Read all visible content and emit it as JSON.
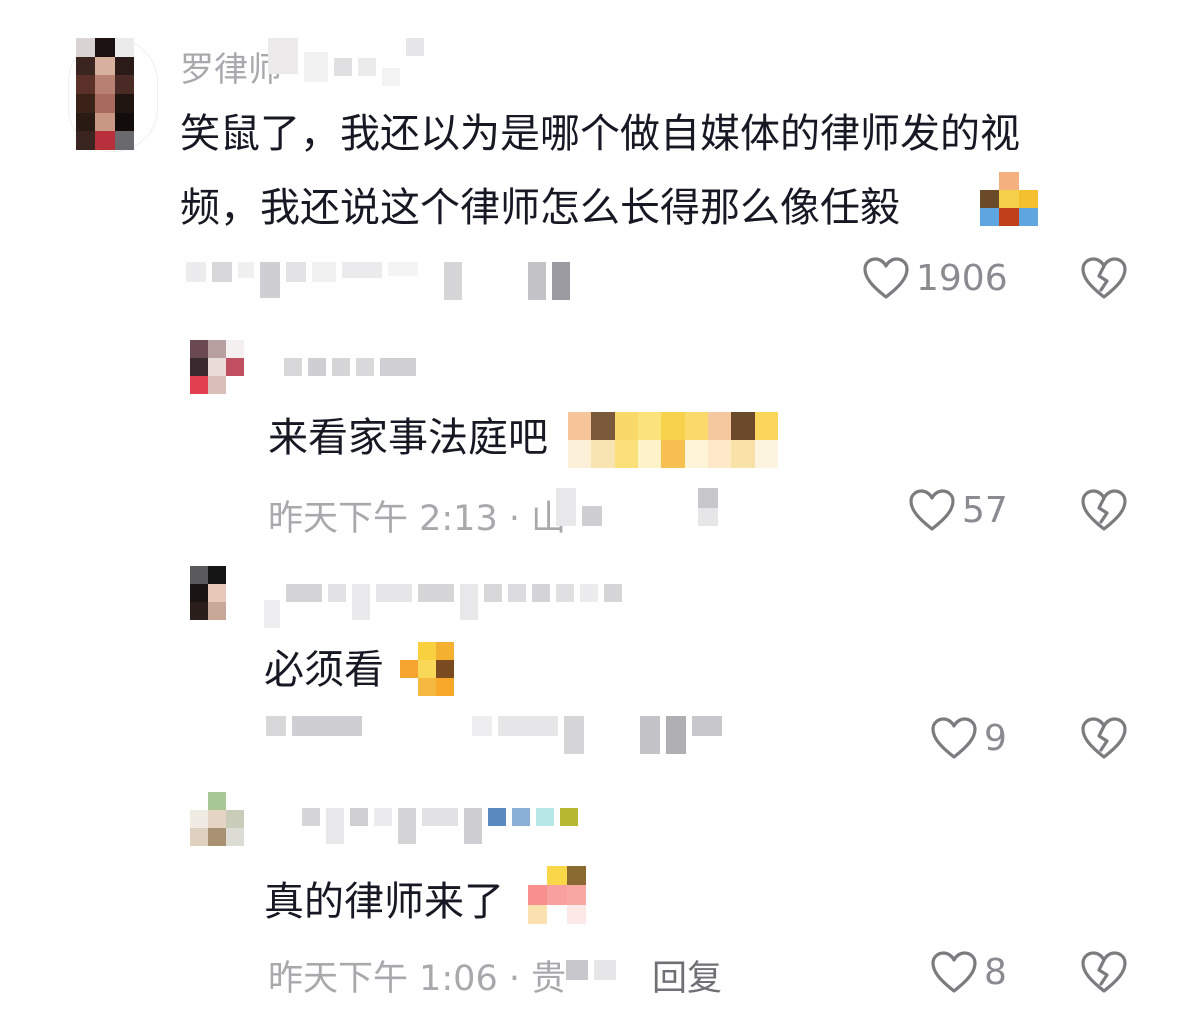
{
  "comments": [
    {
      "username": "罗律师",
      "text_line1": "笑鼠了，我还以为是哪个做自媒体的律师发的视",
      "text_line2": "频，我还说这个律师怎么长得那么像任毅",
      "likes": "1906"
    },
    {
      "text": "来看家事法庭吧",
      "meta": "昨天下午 2:13 · 山",
      "likes": "57"
    },
    {
      "text": "必须看",
      "likes": "9"
    },
    {
      "text": "真的律师来了",
      "meta": "昨天下午 1:06 · 贵",
      "reply_label": "回复",
      "likes": "8"
    }
  ],
  "icons": {
    "like": "heart-outline-icon",
    "dislike": "broken-heart-icon"
  },
  "colors": {
    "text": "#161823",
    "muted": "#a8a8ad",
    "count": "#8a8a90",
    "icon": "#7b7b80"
  }
}
